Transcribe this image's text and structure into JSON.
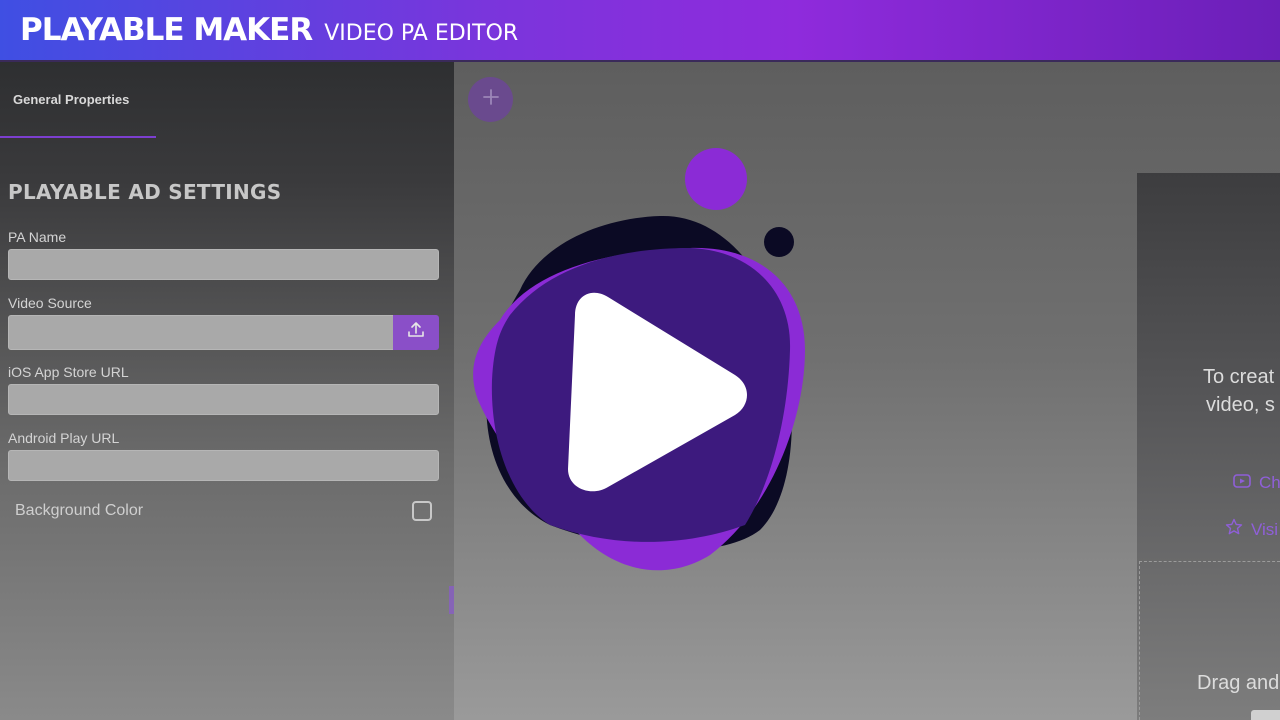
{
  "header": {
    "brand": "PLAYABLE MAKER",
    "subtitle": "VIDEO PA EDITOR"
  },
  "left_panel": {
    "tab_label": "General Properties",
    "section_title": "PLAYABLE AD SETTINGS",
    "fields": {
      "pa_name": {
        "label": "PA Name",
        "value": ""
      },
      "video_source": {
        "label": "Video Source",
        "value": ""
      },
      "ios_url": {
        "label": "iOS App Store URL",
        "value": ""
      },
      "android_url": {
        "label": "Android Play URL",
        "value": ""
      }
    },
    "background_color": {
      "label": "Background Color",
      "checked": false
    }
  },
  "canvas": {
    "right_card": {
      "line1": "To creat",
      "line2": "video, s",
      "link1": "Ch",
      "link2": "Visi",
      "drag_text": "Drag and"
    }
  },
  "colors": {
    "accent": "#8f2bdc",
    "play_dark": "#0b0a24",
    "play_purple": "#8b2bd6",
    "play_overlap": "#3d1a7e"
  },
  "icons": [
    "upload-icon",
    "plus-icon",
    "youtube-icon",
    "star-icon",
    "play-icon"
  ]
}
